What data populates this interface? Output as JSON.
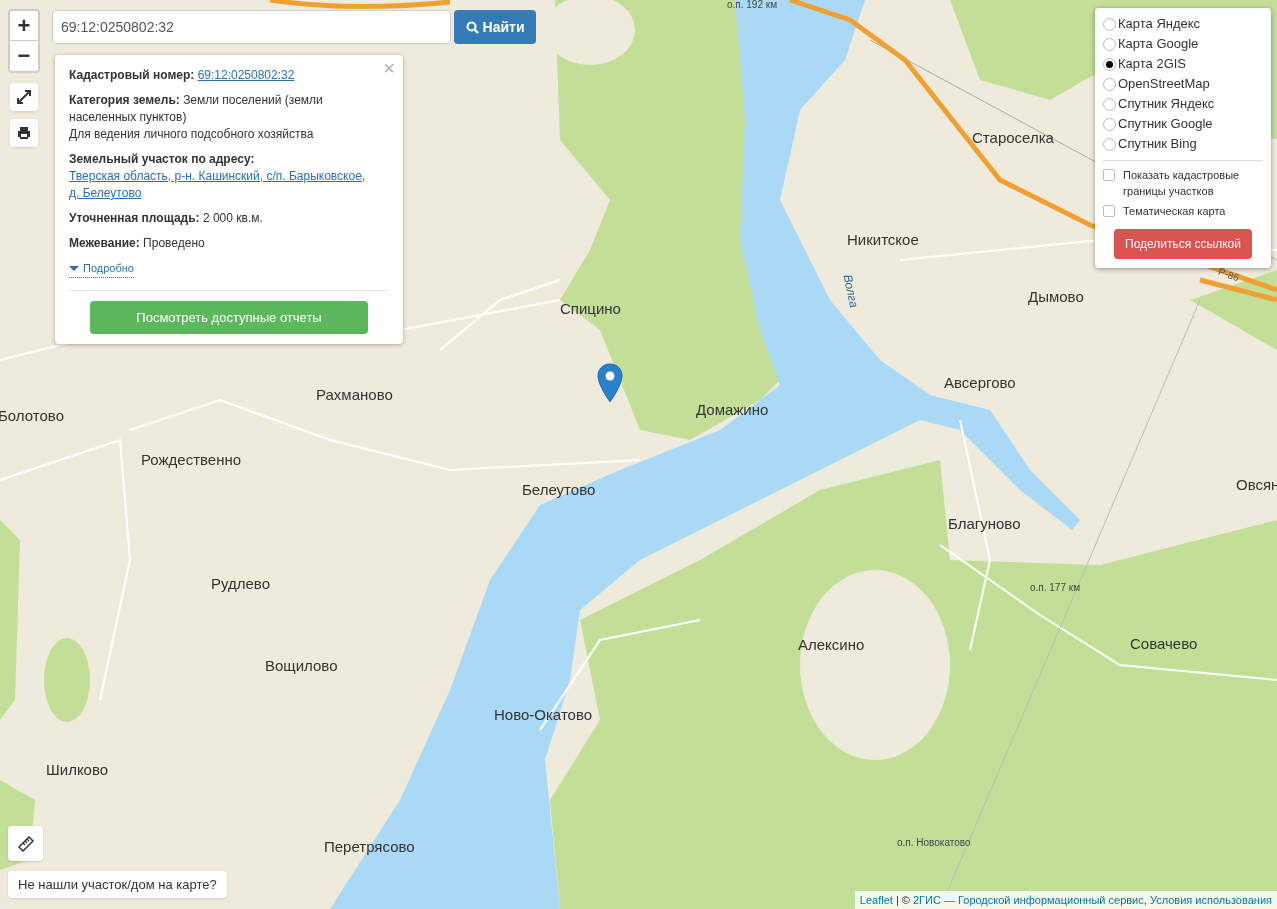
{
  "zoom": {
    "in": "+",
    "out": "−"
  },
  "search": {
    "value": "69:12:0250802:32",
    "button": "Найти"
  },
  "popup": {
    "close": "×",
    "fields": [
      {
        "label": "Кадастровый номер:",
        "value": "69:12:0250802:32",
        "kind": "link"
      },
      {
        "label": "Категория земель:",
        "value": "Земли поселений (земли населенных пунктов)",
        "note": "Для ведения личного подсобного хозяйства",
        "kind": "text"
      },
      {
        "label": "Земельный участок по адресу:",
        "value": "Тверская область, р-н. Кашинский, с/п. Барыковское, д. Белеутово",
        "kind": "link"
      },
      {
        "label": "Уточненная площадь:",
        "value": "2 000 кв.м.",
        "kind": "text"
      },
      {
        "label": "Межевание:",
        "value": "Проведено",
        "kind": "text"
      }
    ],
    "details": {
      "label": "Подробно",
      "expanded": false
    },
    "reports_button": "Посмотреть доступные отчеты"
  },
  "layers": {
    "base": [
      {
        "label": "Карта Яндекс",
        "selected": false
      },
      {
        "label": "Карта Google",
        "selected": false
      },
      {
        "label": "Карта 2GIS",
        "selected": true
      },
      {
        "label": "OpenStreetMap",
        "selected": false
      },
      {
        "label": "Спутник Яндекс",
        "selected": false
      },
      {
        "label": "Спутник Google",
        "selected": false
      },
      {
        "label": "Спутник Bing",
        "selected": false
      }
    ],
    "overlays": [
      {
        "label": "Показать кадастровые границы участков",
        "checked": false
      },
      {
        "label": "Тематическая карта",
        "checked": false
      }
    ],
    "share_button": "Поделиться ссылкой"
  },
  "map_labels": [
    {
      "text": "о.п. 192 км",
      "kind": "stop"
    },
    {
      "text": "Староселка",
      "kind": "place"
    },
    {
      "text": "Никитское",
      "kind": "place"
    },
    {
      "text": "Волга",
      "kind": "river"
    },
    {
      "text": "Р-86",
      "kind": "road"
    },
    {
      "text": "Спицино",
      "kind": "place"
    },
    {
      "text": "Дымово",
      "kind": "place"
    },
    {
      "text": "Рахманово",
      "kind": "place"
    },
    {
      "text": "Авсергово",
      "kind": "place"
    },
    {
      "text": "Болотово",
      "kind": "place"
    },
    {
      "text": "Домажино",
      "kind": "place"
    },
    {
      "text": "Рождественно",
      "kind": "place"
    },
    {
      "text": "Овсян",
      "kind": "place"
    },
    {
      "text": "Белеутово",
      "kind": "place"
    },
    {
      "text": "Благуново",
      "kind": "place"
    },
    {
      "text": "Рудлево",
      "kind": "place"
    },
    {
      "text": "о.п. 177 км",
      "kind": "stop"
    },
    {
      "text": "Алексино",
      "kind": "place"
    },
    {
      "text": "Совачево",
      "kind": "place"
    },
    {
      "text": "Вощилово",
      "kind": "place"
    },
    {
      "text": "Ново-Окатово",
      "kind": "place"
    },
    {
      "text": "Шилково",
      "kind": "place"
    },
    {
      "text": "о.п. Новокатово",
      "kind": "stop"
    },
    {
      "text": "Перетрясово",
      "kind": "place"
    }
  ],
  "missing_button": "Не нашли участок/дом на карте?",
  "attribution": [
    {
      "text": "Leaflet",
      "kind": "link"
    },
    {
      "text": " | © ",
      "kind": "text"
    },
    {
      "text": "2ГИС — Городской информационный сервис",
      "kind": "link"
    },
    {
      "text": ", ",
      "kind": "text"
    },
    {
      "text": "Условия использования",
      "kind": "link"
    }
  ]
}
